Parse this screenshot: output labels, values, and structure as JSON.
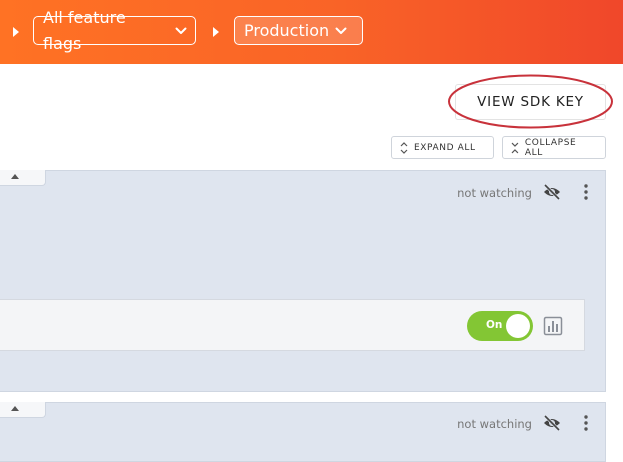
{
  "header": {
    "breadcrumbs": [
      {
        "label": "All feature flags"
      },
      {
        "label": "Production"
      }
    ]
  },
  "sdk_button": {
    "label": "VIEW SDK KEY"
  },
  "controls": {
    "expand_all": "EXPAND ALL",
    "collapse_all": "COLLAPSE ALL"
  },
  "cards": [
    {
      "watch_status": "not watching",
      "toggle": {
        "label": "On",
        "state": "on"
      }
    },
    {
      "watch_status": "not watching"
    }
  ],
  "colors": {
    "header_start": "#ff7224",
    "header_end": "#f0472a",
    "toggle_on": "#83c634",
    "highlight": "#c8323b"
  }
}
